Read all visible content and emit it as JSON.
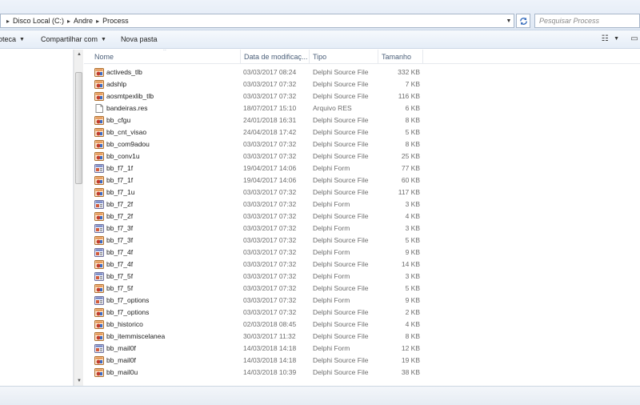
{
  "address": {
    "crumbs": [
      "Disco Local (C:)",
      "Andre",
      "Process"
    ],
    "search_placeholder": "Pesquisar Process"
  },
  "toolbar": {
    "items": [
      {
        "label": "oteca",
        "has_dropdown": true
      },
      {
        "label": "Compartilhar com",
        "has_dropdown": true
      },
      {
        "label": "Nova pasta",
        "has_dropdown": false
      }
    ]
  },
  "columns": {
    "name": "Nome",
    "date": "Data de modificaç...",
    "type": "Tipo",
    "size": "Tamanho"
  },
  "files": [
    {
      "name": "activeds_tlb",
      "date": "03/03/2017 08:24",
      "type": "Delphi Source File",
      "size": "332 KB",
      "icon": "delphi-source-icon"
    },
    {
      "name": "adshlp",
      "date": "03/03/2017 07:32",
      "type": "Delphi Source File",
      "size": "7 KB",
      "icon": "delphi-source-icon"
    },
    {
      "name": "aosmtpexlib_tlb",
      "date": "03/03/2017 07:32",
      "type": "Delphi Source File",
      "size": "116 KB",
      "icon": "delphi-source-icon"
    },
    {
      "name": "bandeiras.res",
      "date": "18/07/2017 15:10",
      "type": "Arquivo RES",
      "size": "6 KB",
      "icon": "res-file-icon"
    },
    {
      "name": "bb_cfgu",
      "date": "24/01/2018 16:31",
      "type": "Delphi Source File",
      "size": "8 KB",
      "icon": "delphi-source-icon"
    },
    {
      "name": "bb_cnt_visao",
      "date": "24/04/2018 17:42",
      "type": "Delphi Source File",
      "size": "5 KB",
      "icon": "delphi-source-icon"
    },
    {
      "name": "bb_com9adou",
      "date": "03/03/2017 07:32",
      "type": "Delphi Source File",
      "size": "8 KB",
      "icon": "delphi-source-icon"
    },
    {
      "name": "bb_conv1u",
      "date": "03/03/2017 07:32",
      "type": "Delphi Source File",
      "size": "25 KB",
      "icon": "delphi-source-icon"
    },
    {
      "name": "bb_f7_1f",
      "date": "19/04/2017 14:06",
      "type": "Delphi Form",
      "size": "77 KB",
      "icon": "delphi-form-icon"
    },
    {
      "name": "bb_f7_1f",
      "date": "19/04/2017 14:06",
      "type": "Delphi Source File",
      "size": "60 KB",
      "icon": "delphi-source-icon"
    },
    {
      "name": "bb_f7_1u",
      "date": "03/03/2017 07:32",
      "type": "Delphi Source File",
      "size": "117 KB",
      "icon": "delphi-source-icon"
    },
    {
      "name": "bb_f7_2f",
      "date": "03/03/2017 07:32",
      "type": "Delphi Form",
      "size": "3 KB",
      "icon": "delphi-form-icon"
    },
    {
      "name": "bb_f7_2f",
      "date": "03/03/2017 07:32",
      "type": "Delphi Source File",
      "size": "4 KB",
      "icon": "delphi-source-icon"
    },
    {
      "name": "bb_f7_3f",
      "date": "03/03/2017 07:32",
      "type": "Delphi Form",
      "size": "3 KB",
      "icon": "delphi-form-icon"
    },
    {
      "name": "bb_f7_3f",
      "date": "03/03/2017 07:32",
      "type": "Delphi Source File",
      "size": "5 KB",
      "icon": "delphi-source-icon"
    },
    {
      "name": "bb_f7_4f",
      "date": "03/03/2017 07:32",
      "type": "Delphi Form",
      "size": "9 KB",
      "icon": "delphi-form-icon"
    },
    {
      "name": "bb_f7_4f",
      "date": "03/03/2017 07:32",
      "type": "Delphi Source File",
      "size": "14 KB",
      "icon": "delphi-source-icon"
    },
    {
      "name": "bb_f7_5f",
      "date": "03/03/2017 07:32",
      "type": "Delphi Form",
      "size": "3 KB",
      "icon": "delphi-form-icon"
    },
    {
      "name": "bb_f7_5f",
      "date": "03/03/2017 07:32",
      "type": "Delphi Source File",
      "size": "5 KB",
      "icon": "delphi-source-icon"
    },
    {
      "name": "bb_f7_options",
      "date": "03/03/2017 07:32",
      "type": "Delphi Form",
      "size": "9 KB",
      "icon": "delphi-form-icon"
    },
    {
      "name": "bb_f7_options",
      "date": "03/03/2017 07:32",
      "type": "Delphi Source File",
      "size": "2 KB",
      "icon": "delphi-source-icon"
    },
    {
      "name": "bb_historico",
      "date": "02/03/2018 08:45",
      "type": "Delphi Source File",
      "size": "4 KB",
      "icon": "delphi-source-icon"
    },
    {
      "name": "bb_itemmiscelanea",
      "date": "30/03/2017 11:32",
      "type": "Delphi Source File",
      "size": "8 KB",
      "icon": "delphi-source-icon"
    },
    {
      "name": "bb_mail0f",
      "date": "14/03/2018 14:18",
      "type": "Delphi Form",
      "size": "12 KB",
      "icon": "delphi-form-icon"
    },
    {
      "name": "bb_mail0f",
      "date": "14/03/2018 14:18",
      "type": "Delphi Source File",
      "size": "19 KB",
      "icon": "delphi-source-icon"
    },
    {
      "name": "bb_mail0u",
      "date": "14/03/2018 10:39",
      "type": "Delphi Source File",
      "size": "38 KB",
      "icon": "delphi-source-icon"
    }
  ]
}
